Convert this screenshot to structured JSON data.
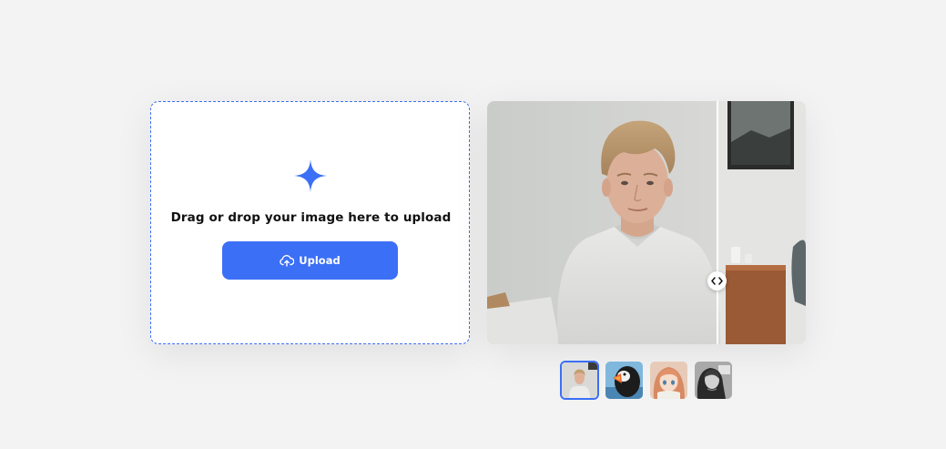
{
  "upload": {
    "prompt_text": "Drag or drop your image here to upload",
    "button_label": "Upload",
    "accent_color": "#3b6ff5"
  },
  "preview": {
    "icons": {
      "compare_handle": "left-right-arrows-icon"
    }
  },
  "samples": [
    {
      "name": "young-man-portrait",
      "selected": true
    },
    {
      "name": "puffin",
      "selected": false
    },
    {
      "name": "anime-girl",
      "selected": false
    },
    {
      "name": "bw-woman-portrait",
      "selected": false
    }
  ]
}
